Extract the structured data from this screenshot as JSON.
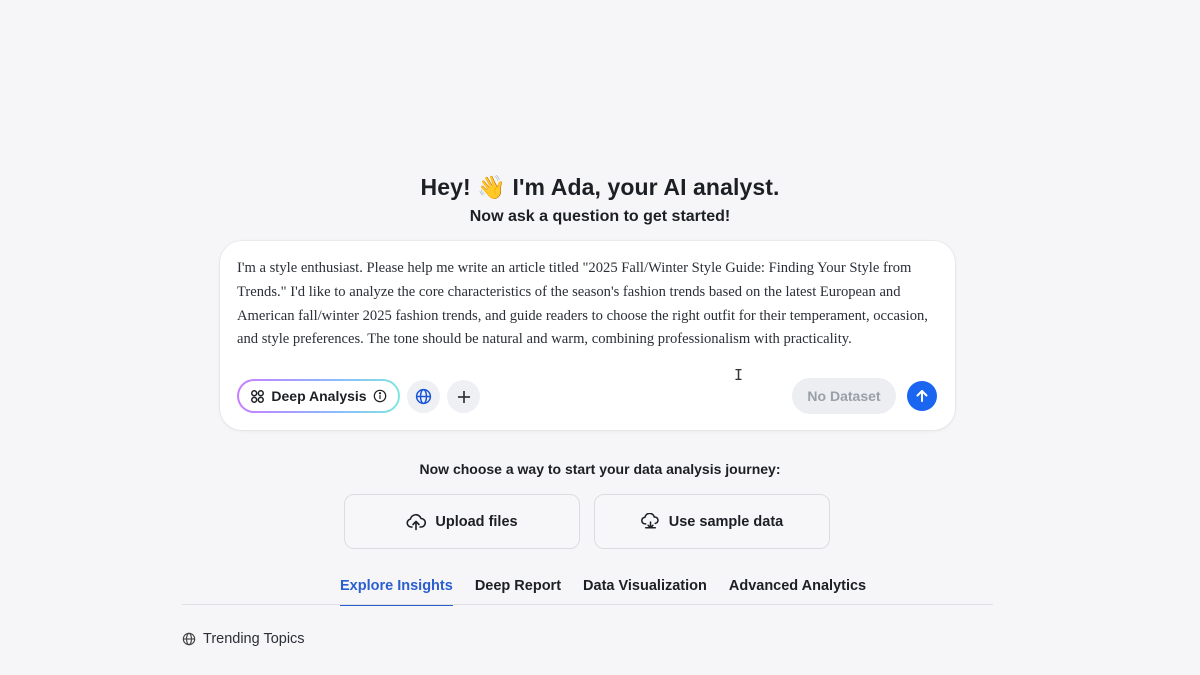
{
  "greeting": {
    "prefix": "Hey!",
    "emoji": "👋",
    "suffix": "I'm Ada, your AI analyst.",
    "subtitle": "Now ask a question to get started!"
  },
  "composer": {
    "prompt_text": "I'm a style enthusiast. Please help me write an article titled \"2025 Fall/Winter Style Guide: Finding Your Style from Trends.\" I'd like to analyze the core characteristics of the season's fashion trends based on the latest European and American fall/winter 2025 fashion trends, and guide readers to choose the right outfit for their temperament, occasion, and style preferences. The tone should be natural and warm, combining professionalism with practicality.",
    "deep_analysis_label": "Deep Analysis",
    "dataset_label": "No Dataset"
  },
  "start": {
    "prompt": "Now choose a way to start your data analysis journey:",
    "upload_label": "Upload files",
    "sample_label": "Use sample data"
  },
  "tabs": [
    {
      "label": "Explore Insights",
      "active": true
    },
    {
      "label": "Deep Report",
      "active": false
    },
    {
      "label": "Data Visualization",
      "active": false
    },
    {
      "label": "Advanced Analytics",
      "active": false
    }
  ],
  "section": {
    "trending_label": "Trending Topics"
  },
  "colors": {
    "accent": "#2b5fd0",
    "send": "#1a66f0",
    "background": "#f6f6f8"
  },
  "icons": [
    "deep-analysis-icon",
    "info-icon",
    "globe-icon",
    "plus-icon",
    "arrow-up-icon",
    "upload-cloud-icon",
    "sample-data-icon",
    "globe-icon"
  ]
}
